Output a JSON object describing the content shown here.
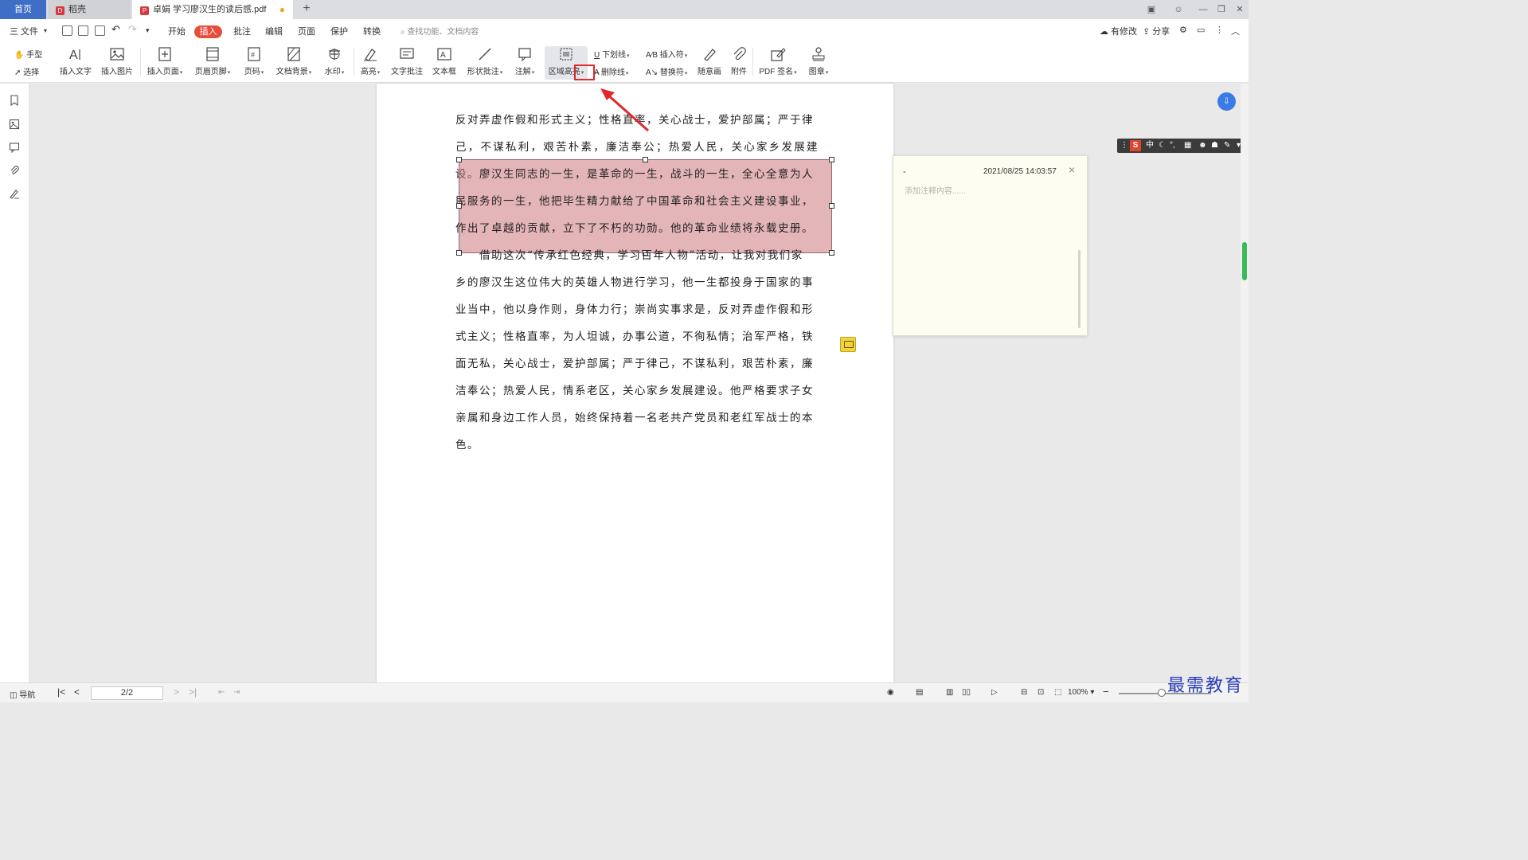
{
  "tabs": {
    "home": "首页",
    "daoke": "稻壳",
    "document": "卓娟 学习廖汉生的读后感.pdf",
    "document_modified_dot": "●",
    "new_tab": "+"
  },
  "menubar": {
    "file": "三 文件",
    "items": [
      "开始",
      "插入",
      "批注",
      "编辑",
      "页面",
      "保护",
      "转换"
    ],
    "active": "插入",
    "search_placeholder": "查找功能、文档内容",
    "right": {
      "modify": "有修改",
      "share": "分享"
    }
  },
  "ribbon": {
    "hand": "手型",
    "select": "选择",
    "insert_text": "插入文字",
    "insert_image": "插入图片",
    "insert_page": "插入页面",
    "header_footer": "页眉页脚",
    "page_number": "页码",
    "doc_background": "文档背景",
    "watermark": "水印",
    "highlight": "高亮",
    "text_comment": "文字批注",
    "text_box": "文本框",
    "shape_comment": "形状批注",
    "annotation": "注解",
    "area_highlight": "区域高亮",
    "underline": "下划线",
    "strikethrough": "删除线",
    "insert_symbol": "插入符",
    "replace_symbol": "替换符",
    "freehand": "随意画",
    "attachment": "附件",
    "pdf_sign": "PDF 签名",
    "stamp": "图章"
  },
  "document": {
    "lines_top": [
      "反对弄虚作假和形式主义；性格直率，关心战士，爱护部属；严于律",
      "己，不谋私利，艰苦朴素，廉洁奉公；热爱人民，关心家乡发展建设。"
    ],
    "highlighted": [
      "　　廖汉生同志的一生，是革命的一生，战斗的一生，全心全意为人",
      "民服务的一生，他把毕生精力献给了中国革命和社会主义建设事业，",
      "作出了卓越的贡献，立下了不朽的功勋。他的革命业绩将永载史册。"
    ],
    "lines_bottom": [
      "　　借助这次“传承红色经典，学习百年人物”活动，让我对我们家",
      "乡的廖汉生这位伟大的英雄人物进行学习，他一生都投身于国家的事",
      "业当中，他以身作则，身体力行；崇尚实事求是，反对弄虚作假和形",
      "式主义；性格直率，为人坦诚，办事公道，不徇私情；治军严格，铁",
      "面无私，关心战士，爱护部属；严于律己，不谋私利，艰苦朴素，廉",
      "洁奉公；热爱人民，情系老区，关心家乡发展建设。他严格要求子女",
      "亲属和身边工作人员，始终保持着一名老共产党员和老红军战士的本",
      "色。"
    ]
  },
  "comment": {
    "author": "-",
    "timestamp": "2021/08/25 14:03:57",
    "placeholder": "添加注释内容......",
    "close": "×"
  },
  "ime": {
    "logo": "S",
    "mode": "中"
  },
  "statusbar": {
    "nav": "导航",
    "page": "2/2",
    "zoom": "100%"
  },
  "watermark": "最需教育",
  "colors": {
    "accent": "#e74c3c",
    "highlight": "#cd787d",
    "tab_home": "#3f6ec6",
    "scroll_thumb": "#3bbb58"
  }
}
